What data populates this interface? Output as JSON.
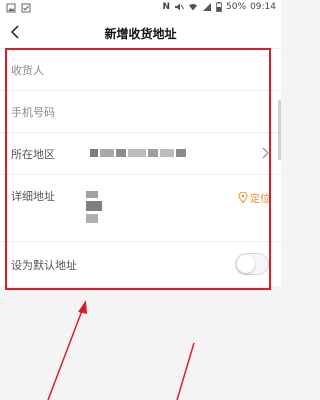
{
  "status_bar": {
    "battery": "50%",
    "time": "09:14",
    "network_label": "N"
  },
  "nav": {
    "title": "新增收货地址"
  },
  "form": {
    "recipient": {
      "placeholder": "收货人"
    },
    "phone": {
      "placeholder": "手机号码"
    },
    "region": {
      "label": "所在地区"
    },
    "address": {
      "label": "详细地址",
      "locate_label": "定位"
    },
    "default_address": {
      "label": "设为默认地址",
      "enabled": false
    }
  },
  "colors": {
    "accent": "#f08a24",
    "annotation": "#d8202a",
    "background": "#f4f4f4"
  }
}
